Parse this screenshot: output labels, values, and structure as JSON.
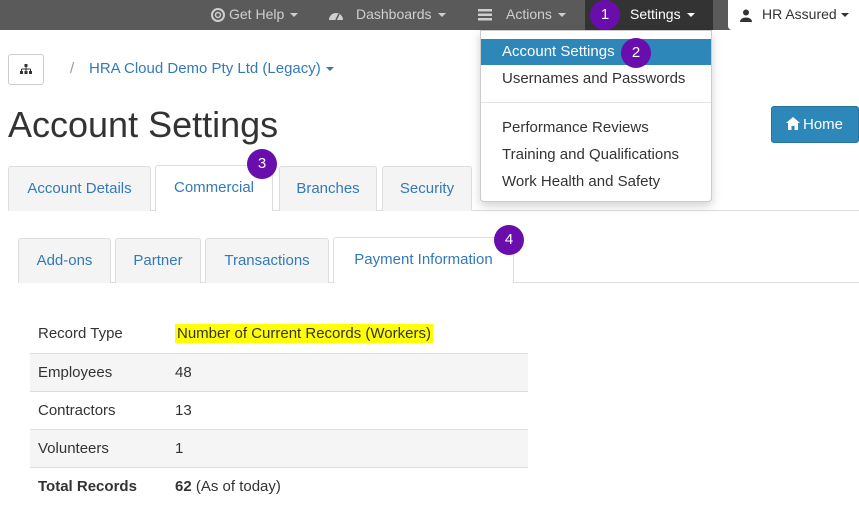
{
  "topnav": {
    "get_help": "Get Help",
    "dashboards": "Dashboards",
    "actions": "Actions",
    "settings": "Settings",
    "user": "HR Assured"
  },
  "steps": [
    "1",
    "2",
    "3",
    "4"
  ],
  "breadcrumb": {
    "separator": "/",
    "organisation": "HRA Cloud Demo Pty Ltd (Legacy)"
  },
  "page_title": "Account Settings",
  "home_button": "Home",
  "main_tabs": [
    {
      "label": "Account Details"
    },
    {
      "label": "Commercial"
    },
    {
      "label": "Branches"
    },
    {
      "label": "Security"
    }
  ],
  "sub_tabs": [
    {
      "label": "Add-ons"
    },
    {
      "label": "Partner"
    },
    {
      "label": "Transactions"
    },
    {
      "label": "Payment Information"
    }
  ],
  "records_table": {
    "rows": [
      {
        "label": "Record Type",
        "value": "Number of Current Records (Workers)"
      },
      {
        "label": "Employees",
        "value": "48"
      },
      {
        "label": "Contractors",
        "value": "13"
      },
      {
        "label": "Volunteers",
        "value": "1"
      },
      {
        "label": "Total Records",
        "value": "62",
        "note": "(As of today)"
      }
    ]
  },
  "settings_menu": {
    "items": [
      "Account Settings",
      "Usernames and Passwords",
      "Performance Reviews",
      "Training and Qualifications",
      "Work Health and Safety"
    ]
  },
  "colors": {
    "topbar": "#5a5a5a",
    "settings_active": "#333333",
    "link": "#337ab7",
    "primary": "#2d87b8",
    "step_marker": "#6a0dad",
    "highlight": "#ffff00"
  }
}
